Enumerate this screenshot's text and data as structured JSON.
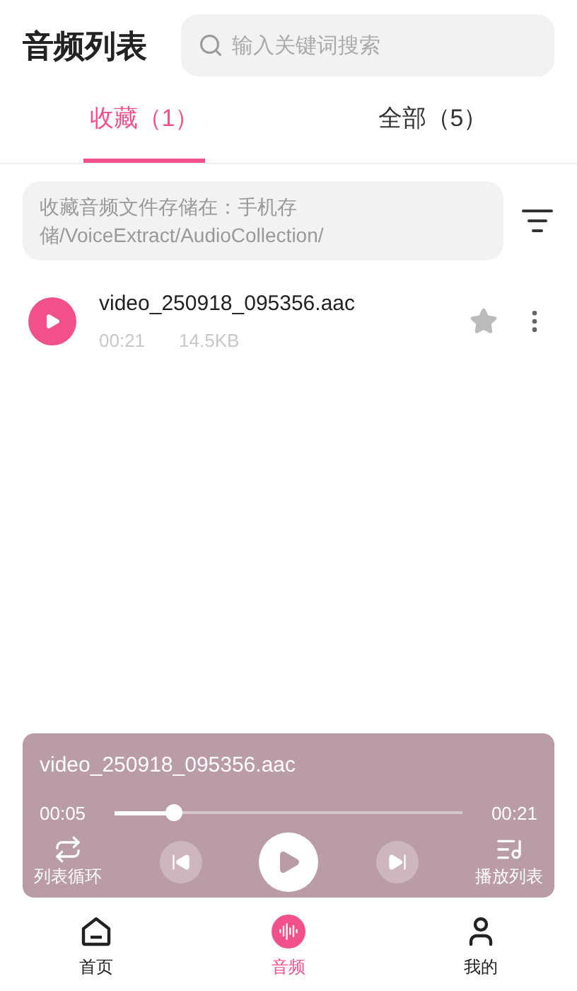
{
  "header": {
    "title": "音频列表",
    "search": {
      "placeholder": "输入关键词搜索"
    }
  },
  "tabs": [
    {
      "label": "收藏（1）",
      "selected": true
    },
    {
      "label": "全部（5）",
      "selected": false
    }
  ],
  "storage_note": "收藏音频文件存储在：手机存储/VoiceExtract/AudioCollection/",
  "files": [
    {
      "name": "video_250918_095356.aac",
      "duration": "00:21",
      "size": "14.5KB",
      "starred": false
    }
  ],
  "player": {
    "title": "video_250918_095356.aac",
    "elapsed": "00:05",
    "total": "00:21",
    "level": 0.17,
    "playing": false,
    "mode_label": "列表循环",
    "playlist_label": "播放列表"
  },
  "bottom_nav": [
    {
      "label": "首页",
      "kind": "home",
      "selected": false
    },
    {
      "label": "音频",
      "kind": "audio",
      "selected": true
    },
    {
      "label": "我的",
      "kind": "profile",
      "selected": false
    }
  ]
}
